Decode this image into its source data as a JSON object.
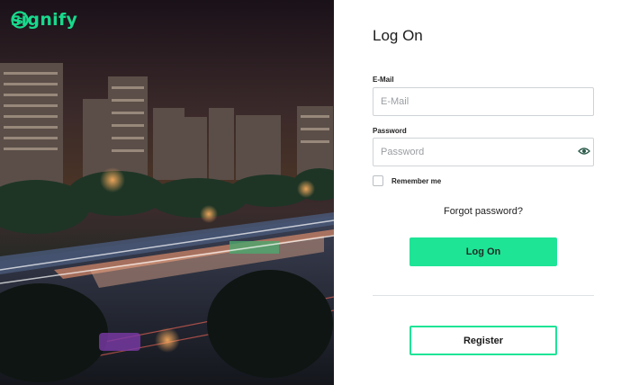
{
  "brand": {
    "name": "signify",
    "accent_color": "#1ee496",
    "logo_color": "#18d98c"
  },
  "hero": {
    "subject": "night city street with tramway station"
  },
  "login": {
    "title": "Log On",
    "email": {
      "label": "E-Mail",
      "placeholder": "E-Mail",
      "value": ""
    },
    "password": {
      "label": "Password",
      "placeholder": "Password",
      "value": ""
    },
    "show_password_icon": "eye-icon",
    "remember_me": {
      "label": "Remember me",
      "checked": false
    },
    "forgot_password": "Forgot password?",
    "submit_label": "Log On",
    "register_label": "Register"
  }
}
